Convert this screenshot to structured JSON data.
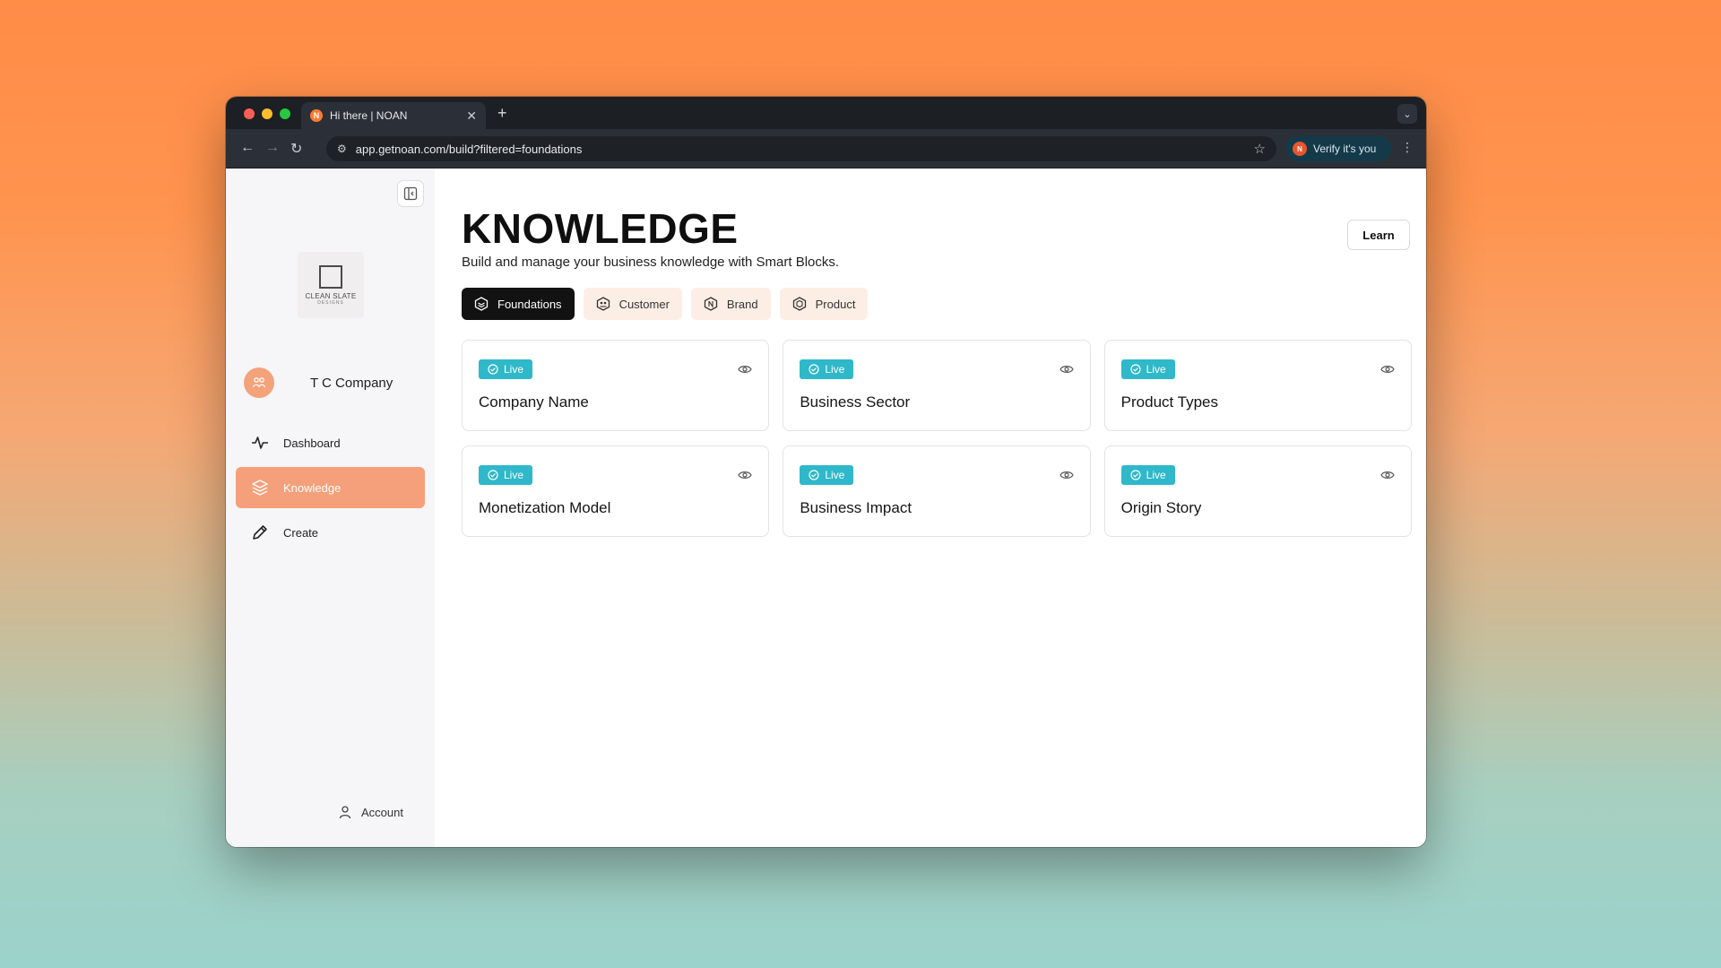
{
  "browser": {
    "tab_title": "Hi there | NOAN",
    "tab_favicon": "N",
    "url": "app.getnoan.com/build?filtered=foundations",
    "verify_label": "Verify it's you",
    "verify_badge": "N"
  },
  "sidebar": {
    "logo_text": "CLEAN SLATE",
    "logo_subtext": "DESIGNS",
    "company_name": "T C Company",
    "items": [
      {
        "label": "Dashboard",
        "icon": "activity-icon",
        "active": false
      },
      {
        "label": "Knowledge",
        "icon": "layers-icon",
        "active": true
      },
      {
        "label": "Create",
        "icon": "pencil-icon",
        "active": false
      }
    ],
    "account_label": "Account"
  },
  "main": {
    "title": "KNOWLEDGE",
    "subtitle": "Build and manage your business knowledge with Smart Blocks.",
    "learn_label": "Learn",
    "filters": [
      {
        "label": "Foundations",
        "active": true
      },
      {
        "label": "Customer",
        "active": false
      },
      {
        "label": "Brand",
        "active": false
      },
      {
        "label": "Product",
        "active": false
      }
    ],
    "cards": [
      {
        "status": "Live",
        "title": "Company Name"
      },
      {
        "status": "Live",
        "title": "Business Sector"
      },
      {
        "status": "Live",
        "title": "Product Types"
      },
      {
        "status": "Live",
        "title": "Monetization Model"
      },
      {
        "status": "Live",
        "title": "Business Impact"
      },
      {
        "status": "Live",
        "title": "Origin Story"
      }
    ]
  },
  "colors": {
    "accent": "#f5a07a",
    "live_badge": "#2fb8c9",
    "chip_bg": "#fdeee5"
  }
}
